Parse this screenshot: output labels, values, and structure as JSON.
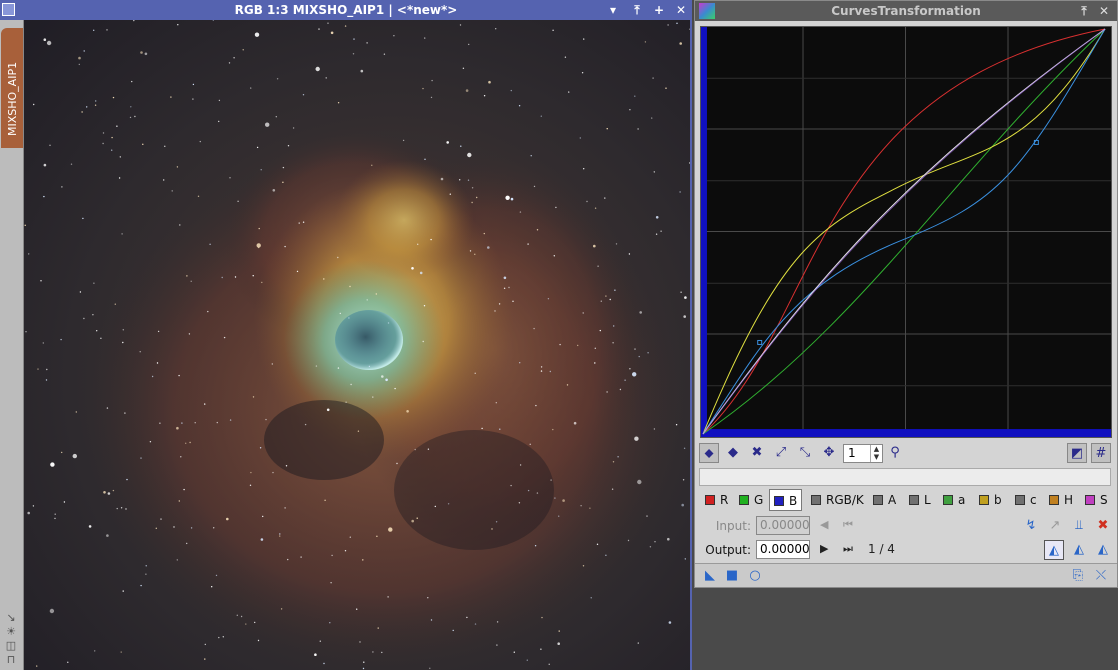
{
  "image_window": {
    "title": "RGB 1:3 MIXSHO_AIP1 | <*new*>",
    "side_tab_label": "MIXSHO_AIP1",
    "title_buttons": [
      "▾",
      "⤒",
      "+",
      "✕"
    ]
  },
  "curves": {
    "title": "CurvesTransformation",
    "title_buttons": [
      "⤒",
      "✕"
    ],
    "zoom": "1",
    "channels": [
      {
        "label": "R",
        "color": "#d02020"
      },
      {
        "label": "G",
        "color": "#20b020"
      },
      {
        "label": "B",
        "color": "#2020c0"
      },
      {
        "label": "RGB/K",
        "color": "#808080"
      },
      {
        "label": "A",
        "color": "#808080"
      },
      {
        "label": "L",
        "color": "#808080"
      },
      {
        "label": "a",
        "color": "#40a040"
      },
      {
        "label": "b",
        "color": "#c0a020"
      },
      {
        "label": "c",
        "color": "#808080"
      },
      {
        "label": "H",
        "color": "#c08020"
      },
      {
        "label": "S",
        "color": "#c040c0"
      }
    ],
    "input_label": "Input:",
    "input_value": "0.00000",
    "output_label": "Output:",
    "output_value": "0.00000",
    "point_counter": "1 / 4"
  }
}
